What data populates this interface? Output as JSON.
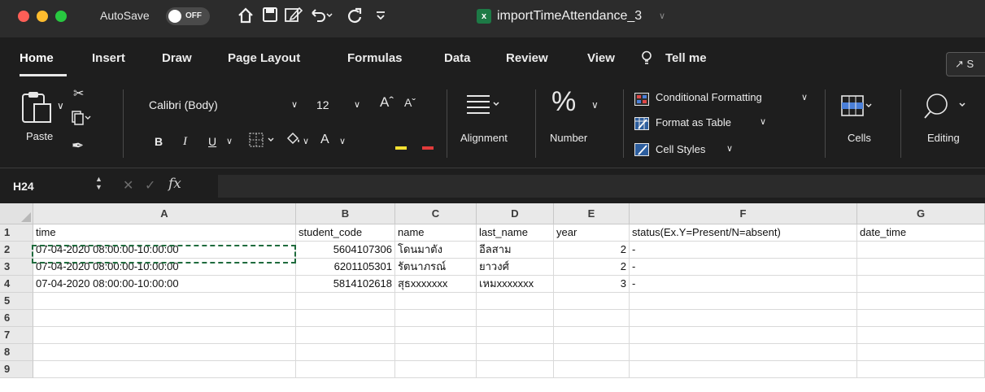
{
  "titlebar": {
    "autosave_label": "AutoSave",
    "autosave_state": "OFF",
    "document_title": "importTimeAttendance_3",
    "icons": [
      "home-icon",
      "save-icon",
      "edit-icon",
      "undo-icon",
      "redo-icon",
      "customize-toolbar-icon"
    ]
  },
  "tabs": [
    "Home",
    "Insert",
    "Draw",
    "Page Layout",
    "Formulas",
    "Data",
    "Review",
    "View",
    "Tell me"
  ],
  "active_tab": "Home",
  "share_label": "S",
  "ribbon": {
    "paste": "Paste",
    "font_name": "Calibri (Body)",
    "font_size": "12",
    "bold": "B",
    "italic": "I",
    "underline": "U",
    "alignment": "Alignment",
    "number": "Number",
    "conditional_formatting": "Conditional Formatting",
    "format_as_table": "Format as Table",
    "cell_styles": "Cell Styles",
    "cells": "Cells",
    "editing": "Editing"
  },
  "formula_bar": {
    "name_box": "H24",
    "fx": "fx",
    "content": ""
  },
  "sheet": {
    "columns": [
      "A",
      "B",
      "C",
      "D",
      "E",
      "F",
      "G"
    ],
    "row_numbers": [
      "1",
      "2",
      "3",
      "4",
      "5",
      "6",
      "7",
      "8",
      "9"
    ],
    "rows": [
      [
        "time",
        "student_code",
        "name",
        "last_name",
        "year",
        "status(Ex.Y=Present/N=absent)",
        "date_time"
      ],
      [
        "07-04-2020 08:00:00-10:00:00",
        "5604107306",
        "โดนมาตัง",
        "อีลสาม",
        "2",
        "-",
        ""
      ],
      [
        "07-04-2020 08:00:00-10:00:00",
        "6201105301",
        "รัตนาภรณ์",
        "ยาวงศ์",
        "2",
        "-",
        ""
      ],
      [
        "07-04-2020 08:00:00-10:00:00",
        "5814102618",
        "สุธxxxxxxx",
        "เหมxxxxxxx",
        "3",
        "-",
        ""
      ],
      [
        "",
        "",
        "",
        "",
        "",
        "",
        ""
      ],
      [
        "",
        "",
        "",
        "",
        "",
        "",
        ""
      ],
      [
        "",
        "",
        "",
        "",
        "",
        "",
        ""
      ],
      [
        "",
        "",
        "",
        "",
        "",
        "",
        ""
      ],
      [
        "",
        "",
        "",
        "",
        "",
        "",
        ""
      ]
    ],
    "copy_range": "A2",
    "accent_color": "#1f6b3d"
  }
}
